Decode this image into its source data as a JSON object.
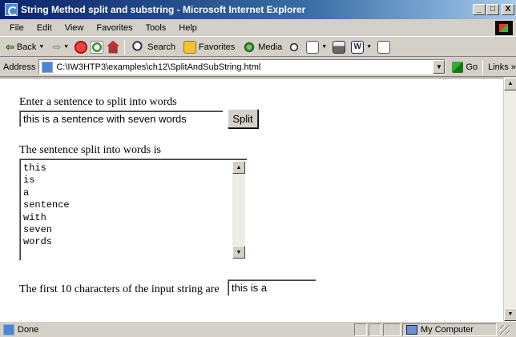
{
  "window": {
    "title": "String Method split and substring - Microsoft Internet Explorer",
    "controls": {
      "minimize": "_",
      "maximize": "□",
      "close": "X"
    }
  },
  "menubar": {
    "items": [
      "File",
      "Edit",
      "View",
      "Favorites",
      "Tools",
      "Help"
    ]
  },
  "toolbar": {
    "back_label": "Back",
    "search_label": "Search",
    "favorites_label": "Favorites",
    "media_label": "Media",
    "icons": [
      "back-arrow-icon",
      "forward-arrow-icon",
      "stop-icon",
      "refresh-icon",
      "home-icon",
      "search-icon",
      "favorites-icon",
      "media-icon",
      "history-icon",
      "mail-icon",
      "print-icon",
      "word-icon",
      "edit-icon"
    ]
  },
  "address": {
    "label": "Address",
    "url": "C:\\IW3HTP3\\examples\\ch12\\SplitAndSubString.html",
    "go_label": "Go",
    "links_label": "Links"
  },
  "page": {
    "prompt_text": "Enter a sentence to split into words",
    "input_value": "this is a sentence with seven words",
    "split_button": "Split",
    "result_label": "The sentence split into words is",
    "words": [
      "this",
      "is",
      "a",
      "sentence",
      "with",
      "seven",
      "words"
    ],
    "first_chars_label": "The first 10 characters of the input string are",
    "first_chars_value": "this is a"
  },
  "statusbar": {
    "status_text": "Done",
    "zone_text": "My Computer"
  }
}
